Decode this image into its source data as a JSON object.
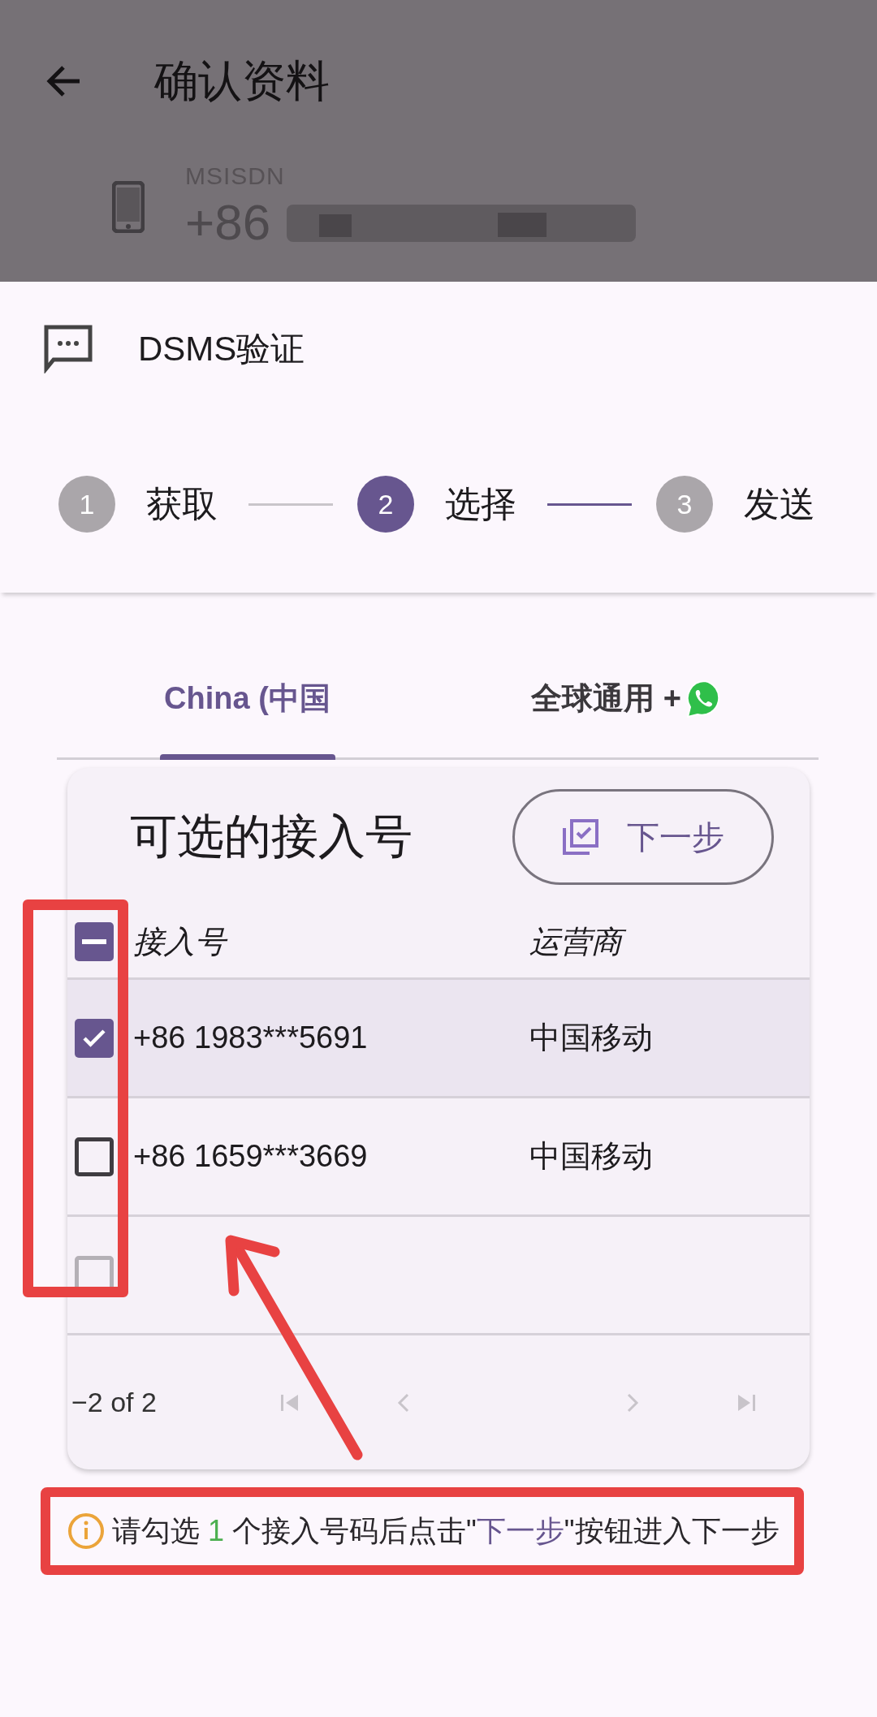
{
  "app_bar": {
    "title": "确认资料",
    "back": true
  },
  "msisdn": {
    "label": "MSISDN",
    "value": "+86"
  },
  "sheet": {
    "title": "DSMS验证"
  },
  "stepper": {
    "steps": [
      {
        "number": "1",
        "label": "获取",
        "active": false
      },
      {
        "number": "2",
        "label": "选择",
        "active": true
      },
      {
        "number": "3",
        "label": "发送",
        "active": false
      }
    ],
    "connectors": [
      {
        "highlighted": false
      },
      {
        "highlighted": true
      }
    ]
  },
  "tabs": [
    {
      "label": "China (中国",
      "selected": true,
      "kind": "text"
    },
    {
      "label": "全球通用 +",
      "selected": false,
      "kind": "text_icon"
    }
  ],
  "card": {
    "title": "可选的接入号",
    "button": "下一步",
    "table": {
      "select_all": {
        "checked": false,
        "indeterminate": true
      },
      "columns": [
        "接入号",
        "运营商"
      ],
      "rows": [
        {
          "number": "+86 1983***5691",
          "carrier": "中国移动",
          "selected": true,
          "disabled": false
        },
        {
          "number": "+86 1659***3669",
          "carrier": "中国移动",
          "selected": false,
          "disabled": false
        },
        {
          "selected": false,
          "disabled": true
        }
      ]
    },
    "pager": {
      "range": "−2 of 2",
      "buttons": [
        {
          "kind": "first",
          "disabled": true
        },
        {
          "kind": "prev",
          "disabled": true
        },
        {
          "kind": "next",
          "disabled": true
        },
        {
          "kind": "last",
          "disabled": true
        }
      ]
    }
  },
  "hint": {
    "outlined": true,
    "parts": [
      {
        "kind": "plain",
        "text": "请勾选 "
      },
      {
        "kind": "count",
        "text": "1"
      },
      {
        "kind": "plain",
        "text": " 个接入号码后点击\""
      },
      {
        "kind": "link",
        "text": "下一步"
      },
      {
        "kind": "plain",
        "text": "\"按钮进入下一步"
      }
    ]
  },
  "markup": {
    "frame": true,
    "arrow": true
  }
}
